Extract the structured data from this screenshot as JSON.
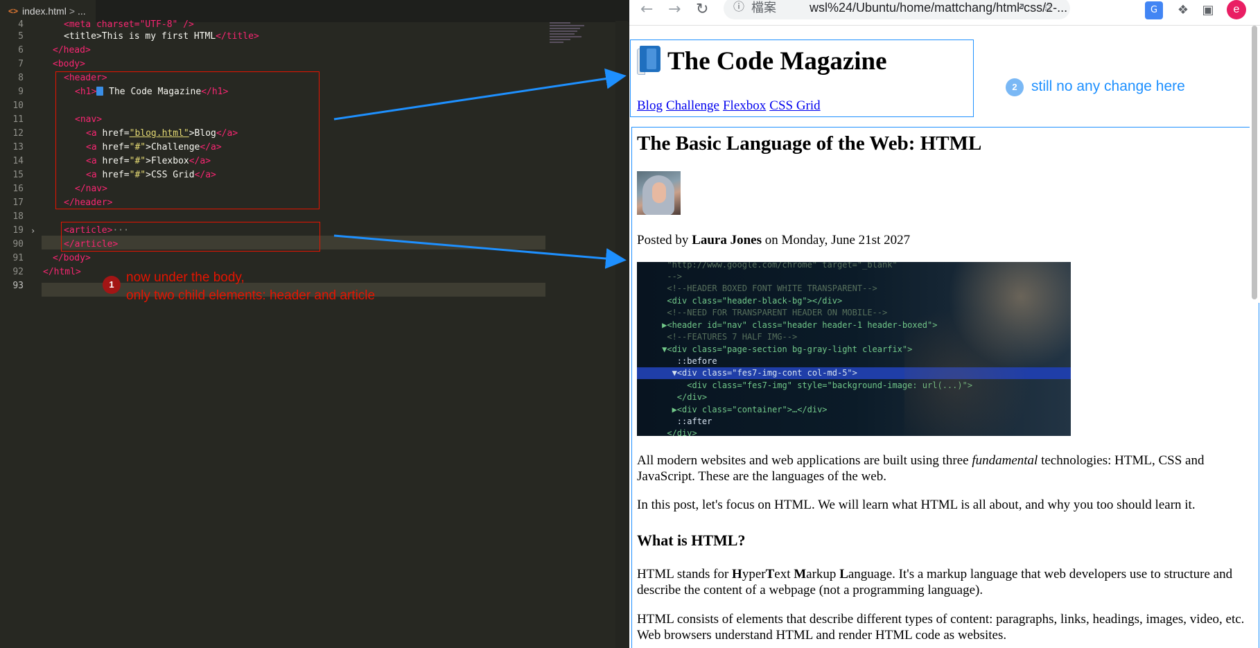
{
  "editor": {
    "tab_icon": "<>",
    "tab_label": "index.html",
    "tab_sep": ">",
    "breadcrumb_more": "...",
    "lines": [
      {
        "num": "4"
      },
      {
        "num": "5"
      },
      {
        "num": "6"
      },
      {
        "num": "7"
      },
      {
        "num": "8"
      },
      {
        "num": "9"
      },
      {
        "num": "10"
      },
      {
        "num": "11"
      },
      {
        "num": "12"
      },
      {
        "num": "13"
      },
      {
        "num": "14"
      },
      {
        "num": "15"
      },
      {
        "num": "16"
      },
      {
        "num": "17"
      },
      {
        "num": "18"
      },
      {
        "num": "19"
      },
      {
        "num": "90"
      },
      {
        "num": "91"
      },
      {
        "num": "92"
      },
      {
        "num": "93"
      }
    ],
    "code": {
      "l4": "<meta charset=\"UTF-8\" />",
      "title_open": "<title>",
      "title_text": "This is my first HTML",
      "title_close": "</title>",
      "head_close": "</head>",
      "body_open": "<body>",
      "header_open": "<header>",
      "h1_open": "<h1>",
      "h1_text": " The Code Magazine",
      "h1_close": "</h1>",
      "nav_open": "<nav>",
      "a1_href": "\"blog.html\"",
      "a1_text": "Blog",
      "a2_text": "Challenge",
      "a3_text": "Flexbox",
      "a4_text": "CSS Grid",
      "a_hash": "\"#\"",
      "nav_close": "</nav>",
      "header_close": "</header>",
      "article_open": "<article>",
      "ellipsis": "···",
      "article_close": "</article>",
      "body_close": "</body>",
      "html_close": "</html>"
    },
    "note1_badge": "1",
    "note1_line1": "now under the body,",
    "note1_line2": "only two child elements: header and article"
  },
  "browser": {
    "url_label": "檔案",
    "url": "wsl%24/Ubuntu/home/mattchang/html-css/2-...",
    "profile_initial": "e",
    "header_title": "The Code Magazine",
    "nav_links": [
      "Blog",
      "Challenge",
      "Flexbox",
      "CSS Grid"
    ],
    "note2_badge": "2",
    "note2_text": "still no any change here",
    "article_title": "The Basic Language of the Web: HTML",
    "posted_prefix": "Posted by ",
    "author": "Laura Jones",
    "posted_suffix": " on Monday, June 21st 2027",
    "image_code_lines": [
      "      \"http://www.google.com/chrome\" target=\"_blank\"",
      "      -->",
      "      <!--HEADER BOXED FONT WHITE TRANSPARENT-->",
      "      <div class=\"header-black-bg\"></div>",
      "      <!--NEED FOR TRANSPARENT HEADER ON MOBILE-->",
      "     ▶<header id=\"nav\" class=\"header header-1 header-boxed\">",
      "      <!--FEATURES 7 HALF IMG-->",
      "     ▼<div class=\"page-section bg-gray-light clearfix\">",
      "        ::before",
      "       ▼<div class=\"fes7-img-cont col-md-5\">",
      "          <div class=\"fes7-img\" style=\"background-image: url(...)\">",
      "        </div>",
      "       ▶<div class=\"container\">…</div>",
      "        ::after",
      "      </div>"
    ],
    "p1_a": "All modern websites and web applications are built using three ",
    "p1_em": "fundamental",
    "p1_b": " technologies: HTML, CSS and JavaScript. These are the languages of the web.",
    "p2": "In this post, let's focus on HTML. We will learn what HTML is all about, and why you too should learn it.",
    "h3": "What is HTML?",
    "p3_parts": [
      "HTML stands for ",
      "H",
      "yper",
      "T",
      "ext ",
      "M",
      "arkup ",
      "L",
      "anguage. It's a markup language that web developers use to structure and describe the content of a webpage (not a programming language)."
    ],
    "p4": "HTML consists of elements that describe different types of content: paragraphs, links, headings, images, video, etc. Web browsers understand HTML and render HTML code as websites."
  },
  "colors": {
    "annotation_red": "#e51400",
    "annotation_blue": "#1e90ff",
    "editor_bg": "#272822",
    "tag_pink": "#f92672",
    "string_yellow": "#e6db74"
  },
  "icons": [
    "html-file-icon",
    "back-arrow-icon",
    "forward-arrow-icon",
    "reload-icon",
    "info-icon",
    "share-icon",
    "star-icon",
    "translate-icon",
    "extensions-icon",
    "sidepanel-icon",
    "book-icon"
  ]
}
